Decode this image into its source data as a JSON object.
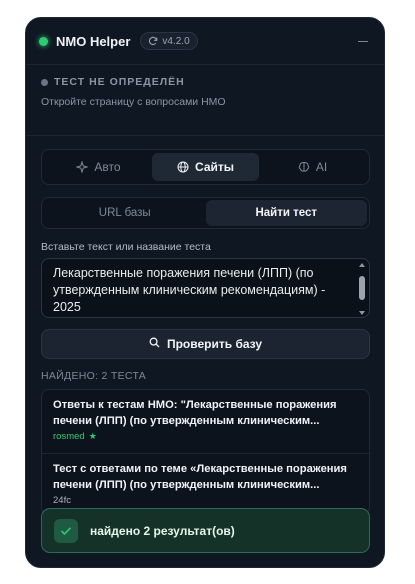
{
  "header": {
    "title": "NMO Helper",
    "version": "v4.2.0"
  },
  "status": {
    "title": "ТЕСТ НЕ ОПРЕДЕЛЁН",
    "hint": "Откройте страницу с вопросами НМО"
  },
  "mode_tabs": [
    {
      "label": "Авто",
      "icon": "magic-wand-icon",
      "active": false
    },
    {
      "label": "Сайты",
      "icon": "globe-icon",
      "active": true
    },
    {
      "label": "AI",
      "icon": "brain-icon",
      "active": false
    }
  ],
  "sub_tabs": [
    {
      "label": "URL базы",
      "active": false
    },
    {
      "label": "Найти тест",
      "active": true
    }
  ],
  "input": {
    "label": "Вставьте текст или название теста",
    "value": "Лекарственные поражения печени (ЛПП) (по утвержденным клиническим рекомендациям) - 2025"
  },
  "check_button": {
    "label": "Проверить базу",
    "icon": "search-icon"
  },
  "results": {
    "heading": "НАЙДЕНО: 2 ТЕСТА",
    "items": [
      {
        "title": "Ответы к тестам НМО: \"Лекарственные поражения печени (ЛПП) (по утвержденным клиническим...",
        "source": "rosmed",
        "starred": true
      },
      {
        "title": "Тест с ответами по теме «Лекарственные поражения печени (ЛПП) (по утвержденным клиническим...",
        "source": "24fc",
        "starred": false
      }
    ]
  },
  "toast": {
    "text": "найдено 2 результат(ов)",
    "icon": "check-icon"
  },
  "colors": {
    "accent_green": "#2ecc71",
    "panel_bg": "#0f1722",
    "toast_bg": "#153228"
  }
}
